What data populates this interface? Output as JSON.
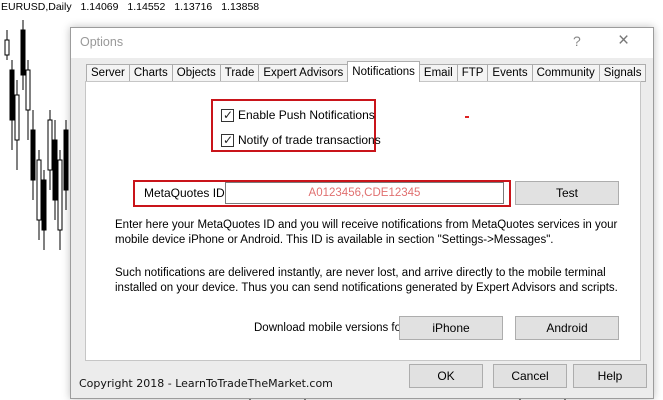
{
  "chart": {
    "symbol": "EURUSD,Daily",
    "quotes": [
      "1.14069",
      "1.14552",
      "1.13716",
      "1.13858"
    ]
  },
  "dialog": {
    "title": "Options",
    "help_glyph": "?",
    "close_glyph": "×",
    "tabs": [
      "Server",
      "Charts",
      "Objects",
      "Trade",
      "Expert Advisors",
      "Notifications",
      "Email",
      "FTP",
      "Events",
      "Community",
      "Signals"
    ],
    "active_tab": "Notifications"
  },
  "notifications": {
    "enable_push_label": "Enable Push Notifications",
    "enable_push_checked": true,
    "notify_trade_label": "Notify of trade transactions",
    "notify_trade_checked": true,
    "metaquotes_id_label": "MetaQuotes ID",
    "metaquotes_id_value": "A0123456,CDE12345",
    "test_button": "Test",
    "paragraph1": "Enter here your MetaQuotes ID and you will receive notifications from MetaQuotes services in your mobile device iPhone or Android. This ID is available in section \"Settings->Messages\".",
    "paragraph2": "Such notifications are delivered instantly, are never lost, and arrive directly to the mobile terminal installed on your device. Thus you can send notifications generated by Expert Advisors and scripts.",
    "download_label": "Download mobile versions for:",
    "iphone_button": "iPhone",
    "android_button": "Android"
  },
  "footer": {
    "ok": "OK",
    "cancel": "Cancel",
    "help": "Help"
  },
  "copyright": "Copyright 2018 - LearnToTradeTheMarket.com",
  "colors": {
    "highlight": "#c9141a",
    "id_text": "#e07070",
    "chart_candles": "#000000"
  }
}
